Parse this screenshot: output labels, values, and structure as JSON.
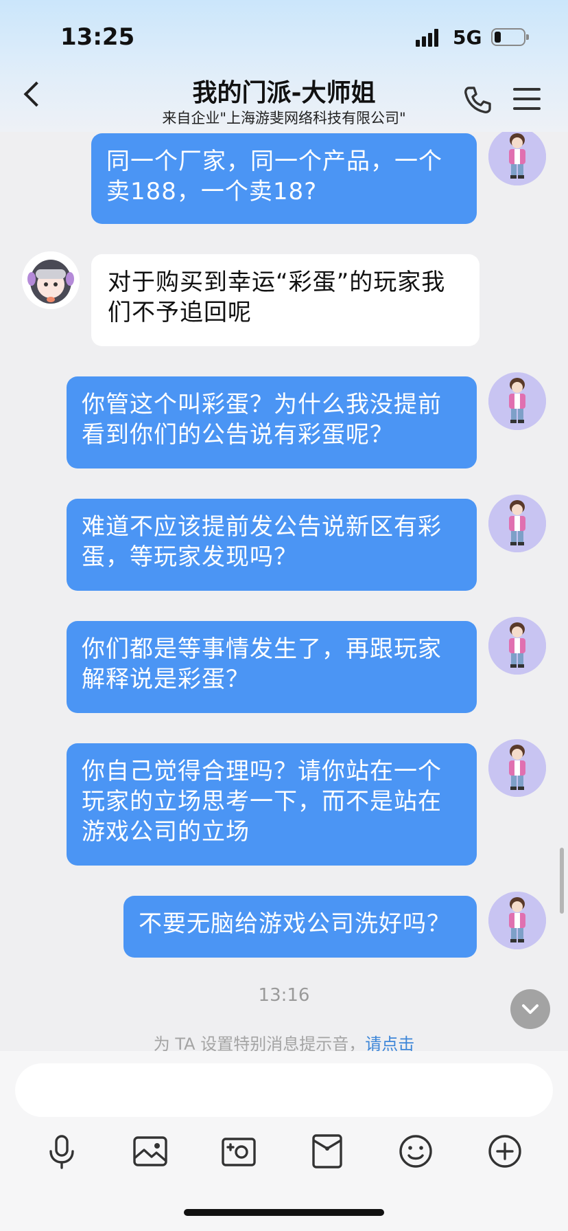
{
  "status": {
    "time": "13:25",
    "network": "5G"
  },
  "header": {
    "title": "我的门派-大师姐",
    "subtitle": "来自企业\"上海游斐网络科技有限公司\""
  },
  "messages": [
    {
      "from": "me",
      "text": "同一个厂家，同一个产品，一个卖188，一个卖18?"
    },
    {
      "from": "them",
      "text": "对于购买到幸运“彩蛋”的玩家我们不予追回呢"
    },
    {
      "from": "me",
      "text": "你管这个叫彩蛋？为什么我没提前看到你们的公告说有彩蛋呢？"
    },
    {
      "from": "me",
      "text": "难道不应该提前发公告说新区有彩蛋，等玩家发现吗？"
    },
    {
      "from": "me",
      "text": "你们都是等事情发生了，再跟玩家解释说是彩蛋？"
    },
    {
      "from": "me",
      "text": "你自己觉得合理吗？请你站在一个玩家的立场思考一下，而不是站在游戏公司的立场"
    },
    {
      "from": "me",
      "text": "不要无脑给游戏公司洗好吗？"
    }
  ],
  "time_separator": "13:16",
  "tip": {
    "text": "为 TA 设置特别消息提示音，",
    "link": "请点击"
  },
  "input": {
    "value": "",
    "placeholder": ""
  },
  "toolbar": [
    "microphone-icon",
    "image-icon",
    "camera-icon",
    "red-packet-icon",
    "emoji-icon",
    "plus-icon"
  ],
  "colors": {
    "my_bubble": "#4b95f4",
    "their_bubble": "#ffffff",
    "background": "#efeff1",
    "link": "#3d86d8"
  }
}
